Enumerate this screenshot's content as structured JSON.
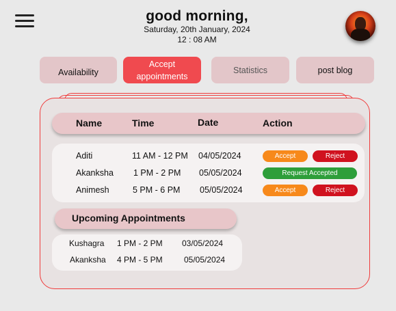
{
  "header": {
    "greeting": "good morning,",
    "date": "Saturday, 20th January, 2024",
    "time": "12 : 08 AM",
    "menu_icon": "hamburger-menu-icon",
    "avatar_icon": "profile-avatar"
  },
  "tabs": [
    {
      "label": "Availability",
      "active": false
    },
    {
      "label": "Accept appointments",
      "active": true
    },
    {
      "label": "Statistics",
      "active": false
    },
    {
      "label": "post blog",
      "active": false
    }
  ],
  "table": {
    "headers": {
      "name": "Name",
      "time": "Time",
      "date": "Date",
      "action": "Action"
    },
    "rows": [
      {
        "name": "Aditi",
        "time": "11 AM - 12 PM",
        "date": "04/05/2024",
        "accept_label": "Accept",
        "reject_label": "Reject"
      },
      {
        "name": "Akanksha",
        "time": "1 PM  - 2 PM",
        "date": "05/05/2024",
        "status_label": "Request Accepted"
      },
      {
        "name": "Animesh",
        "time": "5 PM  - 6 PM",
        "date": "05/05/2024",
        "accept_label": "Accept",
        "reject_label": "Reject"
      }
    ]
  },
  "upcoming": {
    "title": "Upcoming Appointments",
    "rows": [
      {
        "name": "Kushagra",
        "time": "1 PM - 2 PM",
        "date": "03/05/2024"
      },
      {
        "name": "Akanksha",
        "time": "4 PM - 5 PM",
        "date": "05/05/2024"
      }
    ]
  },
  "colors": {
    "accent": "#f04a4f",
    "accept": "#f7891b",
    "reject": "#d0121f",
    "accepted": "#2e9e3a",
    "tab_bg": "#e3c6c9"
  }
}
